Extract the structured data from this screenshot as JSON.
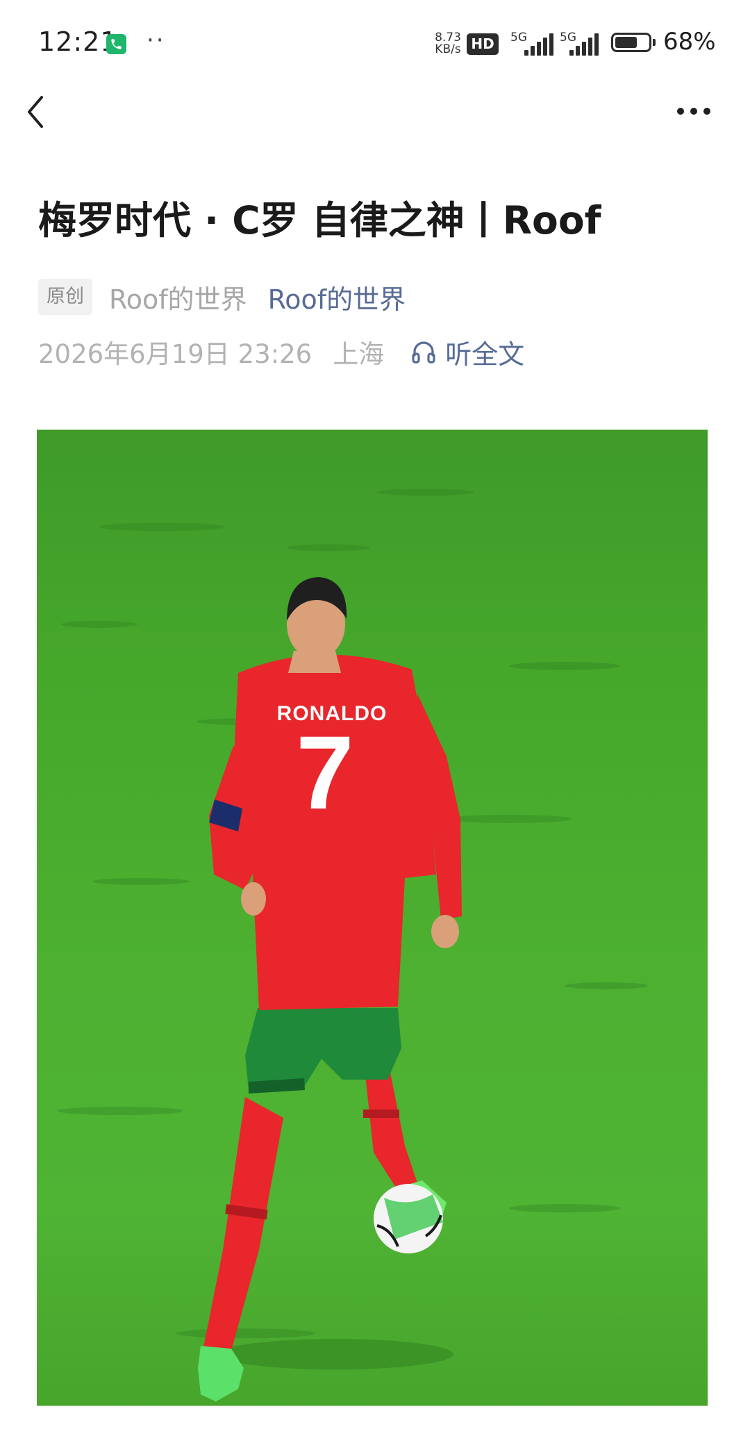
{
  "status_bar": {
    "time": "12:21",
    "dots": "··",
    "net_speed_value": "8.73",
    "net_speed_unit": "KB/s",
    "hd_badge": "HD",
    "network_1": "5G",
    "network_2": "5G",
    "battery_percent": "68%",
    "battery_level": 0.68,
    "call_icon_color": "#1fb66b"
  },
  "nav": {
    "back_icon": "chevron-left-icon",
    "more_icon": "more-horizontal-icon"
  },
  "article": {
    "title": "梅罗时代 · C罗 自律之神丨Roof",
    "original_tag": "原创",
    "author": "Roof的世界",
    "account": "Roof的世界",
    "date": "2026年6月19日 23:26",
    "location": "上海",
    "listen_label": "听全文",
    "listen_icon": "headphones-icon",
    "hero_image": {
      "jersey_name": "RONALDO",
      "jersey_number": "7",
      "pitch_color": "#4db031",
      "kit_color": "#e8262b",
      "shorts_color": "#1f8a3a"
    }
  },
  "colors": {
    "link": "#576b95",
    "muted": "#b2b2b2",
    "title": "#1a1a1a"
  }
}
